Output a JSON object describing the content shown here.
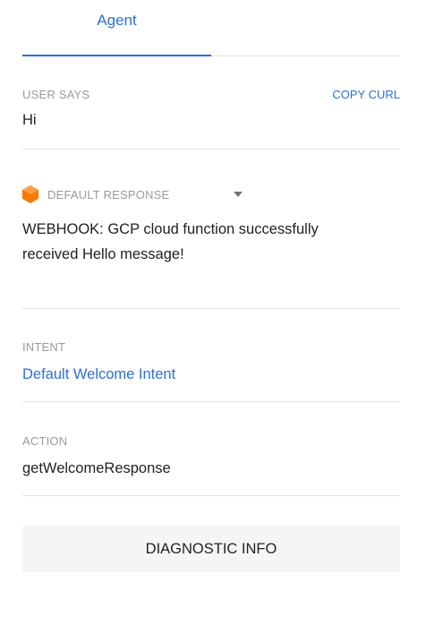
{
  "tabs": [
    {
      "label": "Agent",
      "active": true
    }
  ],
  "user_says": {
    "label": "USER SAYS",
    "copy_label": "COPY CURL",
    "value": "Hi"
  },
  "response": {
    "label": "DEFAULT RESPONSE",
    "icon": "hexagon-icon",
    "icon_color": "#f57c00",
    "line1": "WEBHOOK: GCP cloud function successfully",
    "line2": "received Hello message!"
  },
  "intent": {
    "label": "INTENT",
    "value": "Default Welcome Intent"
  },
  "action": {
    "label": "ACTION",
    "value": "getWelcomeResponse"
  },
  "diagnostic": {
    "label": "DIAGNOSTIC INFO"
  },
  "colors": {
    "accent": "#2d6fd8",
    "label_gray": "#9a9a9a",
    "divider": "#e3e3e3",
    "button_bg": "#f5f5f5"
  }
}
